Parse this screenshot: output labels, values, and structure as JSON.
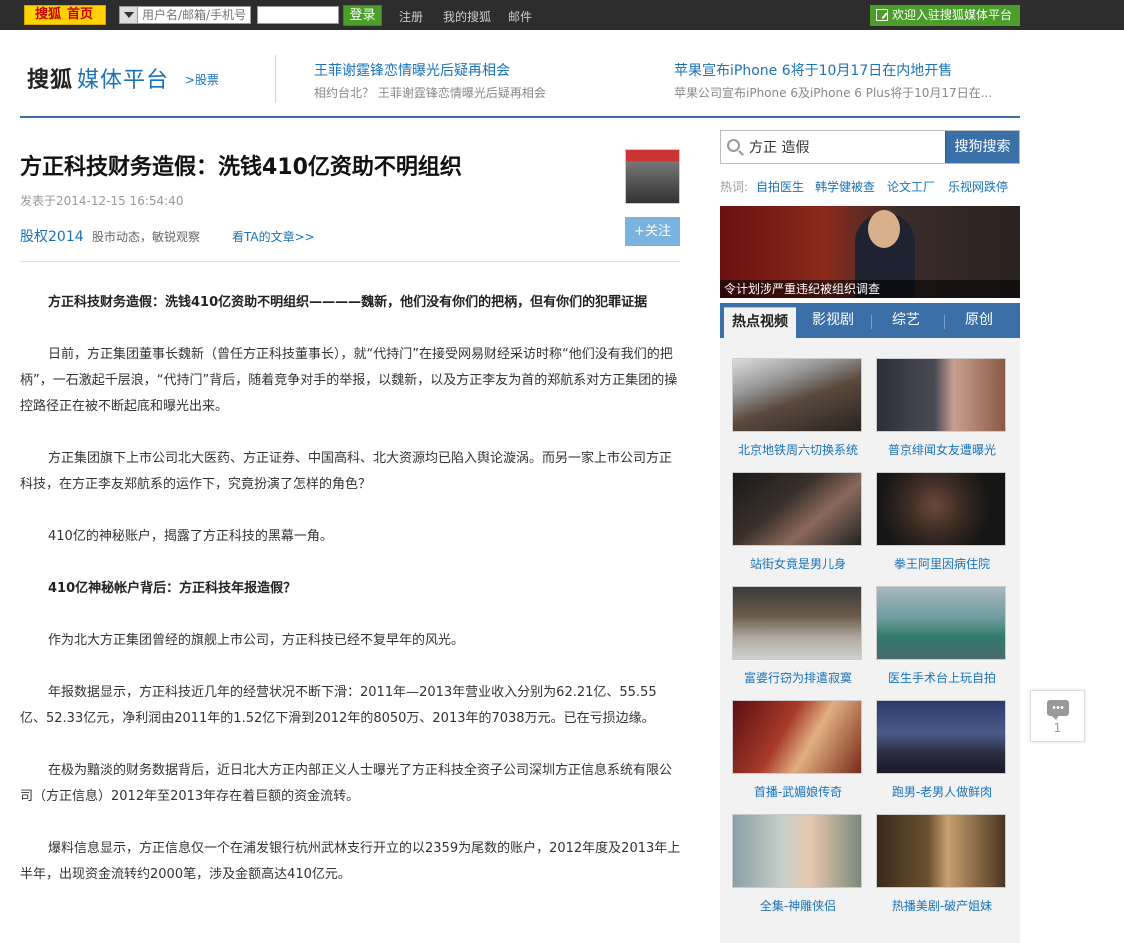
{
  "topbar": {
    "logo": "搜狐",
    "home": "首页",
    "account_placeholder": "用户名/邮箱/手机号",
    "login": "登录",
    "links": [
      "注册",
      "我的搜狐",
      "邮件"
    ],
    "welcome": "欢迎入驻搜狐媒体平台"
  },
  "header": {
    "brand": "搜狐",
    "brand_sub": "媒体平台",
    "channel": ">股票",
    "headlines": [
      {
        "title": "王菲谢霆锋恋情曝光后疑再相会",
        "sub": "相约台北？ 王菲谢霆锋恋情曝光后疑再相会"
      },
      {
        "title": "苹果宣布iPhone 6将于10月17日在内地开售",
        "sub": "苹果公司宣布iPhone 6及iPhone 6 Plus将于10月17日在..."
      }
    ]
  },
  "article": {
    "title": "方正科技财务造假：洗钱410亿资助不明组织",
    "published": "发表于2014-12-15 16:54:40",
    "author": "股权2014",
    "author_desc": "股市动态，敏锐观察",
    "author_link": "看TA的文章>>",
    "follow": "+关注",
    "paragraphs": [
      {
        "bold": true,
        "text": "方正科技财务造假：洗钱410亿资助不明组织————魏新，他们没有你们的把柄，但有你们的犯罪证据"
      },
      {
        "bold": false,
        "text": "日前，方正集团董事长魏新（曾任方正科技董事长），就“代持门”在接受网易财经采访时称“他们没有我们的把柄”，一石激起千层浪，“代持门”背后，随着竞争对手的举报，以魏新，以及方正李友为首的郑航系对方正集团的操控路径正在被不断起底和曝光出来。"
      },
      {
        "bold": false,
        "text": "方正集团旗下上市公司北大医药、方正证券、中国高科、北大资源均已陷入舆论漩涡。而另一家上市公司方正科技，在方正李友郑航系的运作下，究竟扮演了怎样的角色？"
      },
      {
        "bold": false,
        "text": "410亿的神秘账户，揭露了方正科技的黑幕一角。"
      },
      {
        "bold": true,
        "text": "410亿神秘帐户背后：方正科技年报造假？"
      },
      {
        "bold": false,
        "text": "作为北大方正集团曾经的旗舰上市公司，方正科技已经不复早年的风光。"
      },
      {
        "bold": false,
        "text": "年报数据显示，方正科技近几年的经营状况不断下滑：2011年—2013年营业收入分别为62.21亿、55.55亿、52.33亿元，净利润由2011年的1.52亿下滑到2012年的8050万、2013年的7038万元。已在亏损边缘。"
      },
      {
        "bold": false,
        "text": "在极为黯淡的财务数据背后，近日北大方正内部正义人士曝光了方正科技全资子公司深圳方正信息系统有限公司（方正信息）2012年至2013年存在着巨额的资金流转。"
      },
      {
        "bold": false,
        "text": "爆料信息显示，方正信息仅一个在浦发银行杭州武林支行开立的以2359为尾数的账户，2012年度及2013年上半年，出现资金流转约2000笔，涉及金额高达410亿元。"
      }
    ]
  },
  "sidebar": {
    "search_value": "方正 造假",
    "search_button": "搜狗搜索",
    "hot_label": "热词:",
    "hot_words": [
      "自拍医生",
      "韩学健被查",
      "论文工厂",
      "乐视网跌停"
    ],
    "banner_caption": "令计划涉严重违纪被组织调查",
    "tabs": [
      "热点视频",
      "影视剧",
      "综艺",
      "原创"
    ],
    "videos": [
      {
        "caption": "北京地铁周六切换系统"
      },
      {
        "caption": "普京绯闻女友遭曝光"
      },
      {
        "caption": "站街女竟是男儿身"
      },
      {
        "caption": "拳王阿里因病住院"
      },
      {
        "caption": "富婆行窃为排遣寂寞"
      },
      {
        "caption": "医生手术台上玩自拍"
      },
      {
        "caption": "首播-武媚娘传奇"
      },
      {
        "caption": "跑男-老男人做鲜肉"
      },
      {
        "caption": "全集-神雕侠侣"
      },
      {
        "caption": "热播美剧-破产姐妹"
      }
    ],
    "comment_count": "1"
  },
  "colors": {
    "accent_blue": "#3b6fa8",
    "link_blue": "#1a73b8",
    "topbar": "#2d2d2d",
    "green": "#4a9e29",
    "logo_yellow": "#ffd200"
  }
}
